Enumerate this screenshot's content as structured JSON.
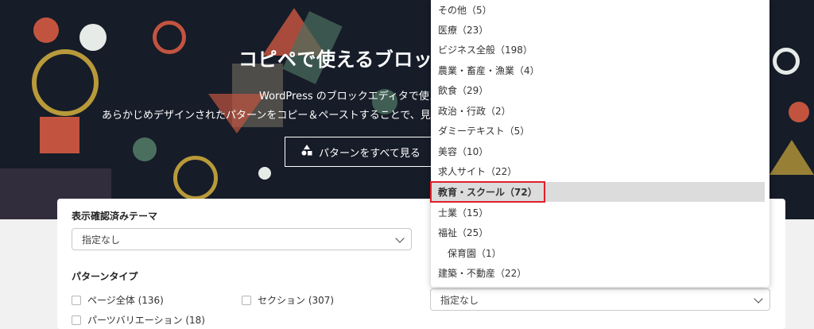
{
  "hero": {
    "title": "コピペで使えるブロック",
    "desc_line1": "WordPress のブロックエディタで使え",
    "desc_line2": "あらかじめデザインされたパターンをコピー＆ペーストすることで、見",
    "button_label": "パターンをすべて見る",
    "button_icon": "shapes-icon"
  },
  "filters": {
    "theme_label": "表示確認済みテーマ",
    "theme_value": "指定なし",
    "pattern_type_label": "パターンタイプ",
    "pattern_types": [
      {
        "label": "ページ全体 (136)"
      },
      {
        "label": "セクション (307)"
      },
      {
        "label": "パーツバリエーション (18)"
      }
    ],
    "category_value": "指定なし"
  },
  "dropdown": {
    "items": [
      {
        "label": "その他（5）"
      },
      {
        "label": "医療（23）"
      },
      {
        "label": "ビジネス全般（198）"
      },
      {
        "label": "農業・畜産・漁業（4）"
      },
      {
        "label": "飲食（29）"
      },
      {
        "label": "政治・行政（2）"
      },
      {
        "label": "ダミーテキスト（5）"
      },
      {
        "label": "美容（10）"
      },
      {
        "label": "求人サイト（22）"
      },
      {
        "label": "教育・スクール（72）"
      },
      {
        "label": "士業（15）"
      },
      {
        "label": "福祉（25）"
      },
      {
        "label": "保育園（1）"
      },
      {
        "label": "建築・不動産（22）"
      }
    ]
  },
  "colors": {
    "hero_bg": "#161c28",
    "highlight": "#e0202a",
    "selected_bg": "#dcdcdc"
  }
}
